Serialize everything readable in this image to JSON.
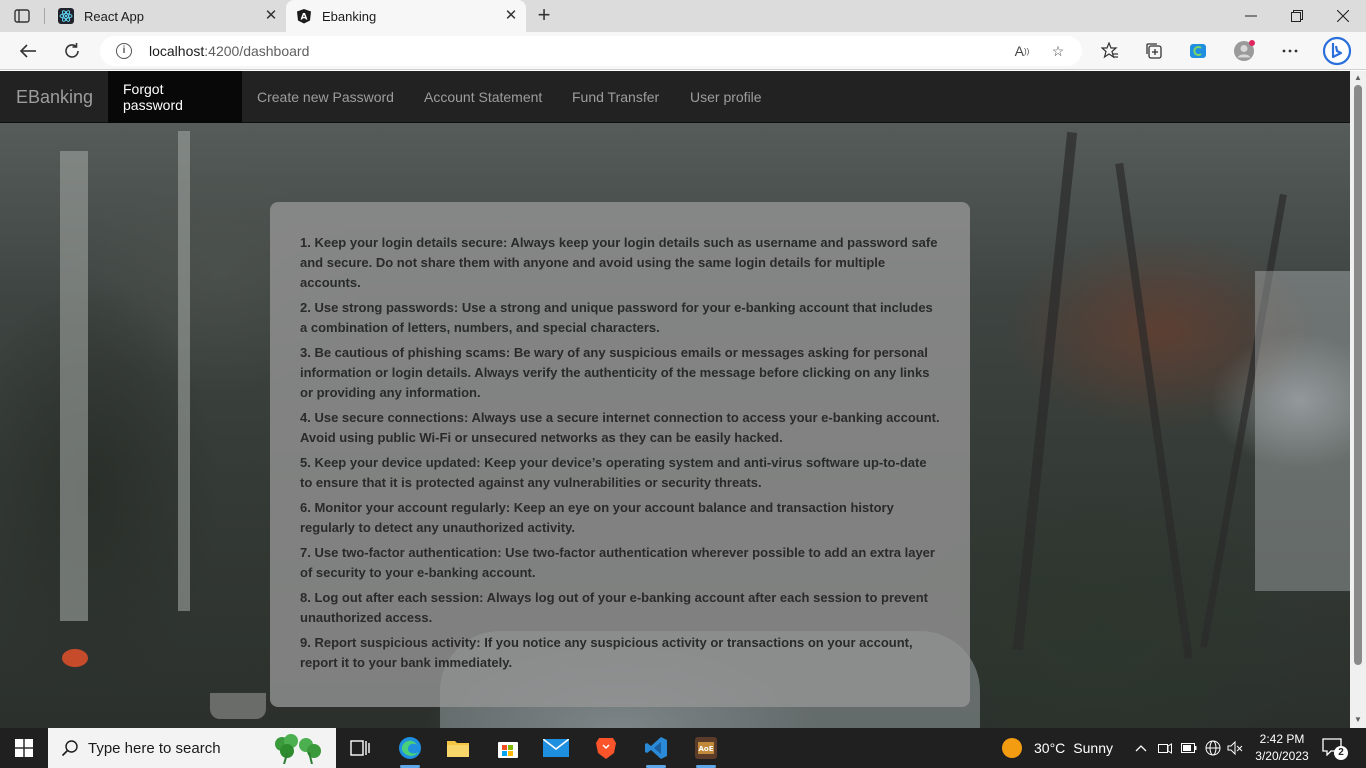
{
  "browser": {
    "tabs": [
      {
        "title": "React App",
        "icon": "react-icon"
      },
      {
        "title": "Ebanking",
        "icon": "angular-icon",
        "active": true
      }
    ],
    "address": {
      "host": "localhost",
      "path": ":4200/dashboard"
    },
    "window_controls": [
      "minimize",
      "restore",
      "close"
    ]
  },
  "app": {
    "brand": "EBanking",
    "nav": [
      {
        "label": "Forgot password",
        "active": true
      },
      {
        "label": "Create new Password"
      },
      {
        "label": "Account Statement"
      },
      {
        "label": "Fund Transfer"
      },
      {
        "label": "User profile"
      }
    ],
    "tips": [
      "1. Keep your login details secure: Always keep your login details such as username and password safe and secure. Do not share them with anyone and avoid using the same login details for multiple accounts.",
      "2. Use strong passwords: Use a strong and unique password for your e-banking account that includes a combination of letters, numbers, and special characters.",
      "3. Be cautious of phishing scams: Be wary of any suspicious emails or messages asking for personal information or login details. Always verify the authenticity of the message before clicking on any links or providing any information.",
      "4. Use secure connections: Always use a secure internet connection to access your e-banking account. Avoid using public Wi-Fi or unsecured networks as they can be easily hacked.",
      "5. Keep your device updated: Keep your device’s operating system and anti-virus software up-to-date to ensure that it is protected against any vulnerabilities or security threats.",
      "6. Monitor your account regularly: Keep an eye on your account balance and transaction history regularly to detect any unauthorized activity.",
      "7. Use two-factor authentication: Use two-factor authentication wherever possible to add an extra layer of security to your e-banking account.",
      "8. Log out after each session: Always log out of your e-banking account after each session to prevent unauthorized access.",
      "9. Report suspicious activity: If you notice any suspicious activity or transactions on your account, report it to your bank immediately."
    ]
  },
  "taskbar": {
    "search_placeholder": "Type here to search",
    "weather": {
      "temp": "30°C",
      "condition": "Sunny"
    },
    "time": "2:42 PM",
    "date": "3/20/2023",
    "notification_count": "2"
  },
  "colors": {
    "navbar_bg": "#222222",
    "navbar_active_bg": "#080808",
    "card_bg": "rgba(150,150,150,0.78)",
    "taskbar_bg": "#202020"
  }
}
